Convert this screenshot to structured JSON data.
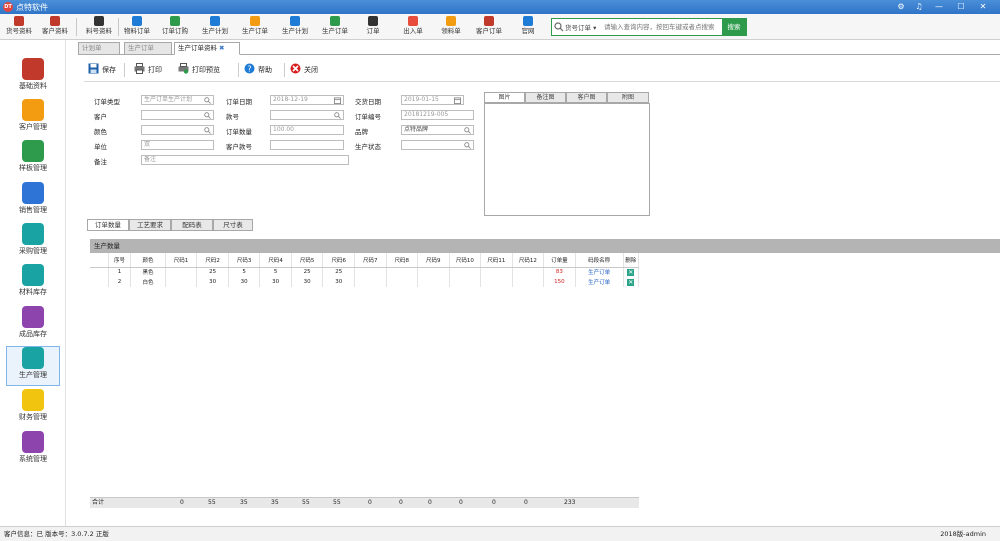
{
  "window": {
    "app_title": "点特软件",
    "logo_text": "DT",
    "controls": [
      "⚙",
      "♫",
      "—",
      "☐",
      "✕"
    ]
  },
  "toolbar": {
    "buttons": [
      {
        "label": "货号资料",
        "icon": "document-icon",
        "color": "#c0392b"
      },
      {
        "label": "客户资料",
        "icon": "contacts-icon",
        "color": "#c0392b"
      },
      {
        "label": "料号资料",
        "icon": "material-icon",
        "color": "#333333"
      },
      {
        "label": "物料订单",
        "icon": "order-icon",
        "color": "#1e7bd6"
      },
      {
        "label": "订单订购",
        "icon": "purchase-icon",
        "color": "#2e9b4c"
      },
      {
        "label": "生产计划",
        "icon": "plan-icon",
        "color": "#1e7bd6"
      },
      {
        "label": "生产订单",
        "icon": "production-icon",
        "color": "#f39c12"
      },
      {
        "label": "生产计划",
        "icon": "schedule-icon",
        "color": "#1e7bd6"
      },
      {
        "label": "生产订单",
        "icon": "workorder-icon",
        "color": "#2e9b4c"
      },
      {
        "label": "订单",
        "icon": "chart-icon",
        "color": "#333333"
      },
      {
        "label": "出入单",
        "icon": "flag-icon",
        "color": "#e74c3c"
      },
      {
        "label": "领料单",
        "icon": "box-icon",
        "color": "#f39c12"
      },
      {
        "label": "客户订单",
        "icon": "user-icon",
        "color": "#c0392b"
      },
      {
        "label": "官网",
        "icon": "browser-icon",
        "color": "#1e7bd6"
      }
    ]
  },
  "search": {
    "combo": "货号订单 ▾",
    "placeholder": "请输入查询内容，按回车键或者点搜索",
    "button": "搜索"
  },
  "sidebar": {
    "items": [
      {
        "label": "基础资料",
        "color": "#c0392b"
      },
      {
        "label": "客户管理",
        "color": "#f39c12"
      },
      {
        "label": "样板管理",
        "color": "#2e9b4c"
      },
      {
        "label": "销售管理",
        "color": "#2e74d6"
      },
      {
        "label": "采购管理",
        "color": "#1aa3a3"
      },
      {
        "label": "材料库存",
        "color": "#1aa3a3"
      },
      {
        "label": "成品库存",
        "color": "#8e44ad"
      },
      {
        "label": "生产管理",
        "color": "#1aa3a3"
      },
      {
        "label": "财务管理",
        "color": "#f1c40f"
      },
      {
        "label": "系统管理",
        "color": "#8e44ad"
      }
    ]
  },
  "doc_tabs": [
    {
      "label": "计划单",
      "active": false
    },
    {
      "label": "生产订单",
      "active": false
    },
    {
      "label": "生产订单资料",
      "active": true
    }
  ],
  "actions": [
    {
      "label": "保存",
      "color": "#1e5fa8"
    },
    {
      "label": "打印",
      "color": "#555555"
    },
    {
      "label": "打印预览",
      "color": "#2e9b4c"
    },
    {
      "label": "帮助",
      "color": "#1e7bd6"
    },
    {
      "label": "关闭",
      "color": "#d62020"
    }
  ],
  "form": {
    "order_type_label": "订单类型",
    "order_type_value": "生产订单生产计划",
    "order_date_label": "订单日期",
    "order_date_value": "2018-12-19",
    "delivery_date_label": "交货日期",
    "delivery_date_value": "2019-01-15",
    "customer_label": "客户",
    "customer_value": "",
    "style_label": "款号",
    "style_value": "",
    "order_no_label": "订单编号",
    "order_no_value": "20181219-005",
    "color_label": "颜色",
    "color_value": "",
    "quantity_label": "订单数量",
    "quantity_value": "100.00",
    "brand_label": "品牌",
    "brand_value": "点特品牌",
    "unit_label": "单位",
    "unit_value": "双",
    "customer_style_label": "客户款号",
    "customer_style_value": "",
    "status_label": "生产状态",
    "status_value": "",
    "remark_label": "备注",
    "remark_value": "备注"
  },
  "right_tabs": [
    "图片",
    "备注图",
    "客户图",
    "附图"
  ],
  "lower_tabs": [
    "订单数量",
    "工艺要求",
    "配码表",
    "尺寸表"
  ],
  "grid": {
    "section_title": "生产数量",
    "columns": [
      "序号",
      "颜色",
      "尺码1",
      "尺码2",
      "尺码3",
      "尺码4",
      "尺码5",
      "尺码6",
      "尺码7",
      "尺码8",
      "尺码9",
      "尺码10",
      "尺码11",
      "尺码12",
      "订单量",
      "码段名称",
      "删除"
    ],
    "rows": [
      {
        "no": "1",
        "color": "黑色",
        "c1": "",
        "c2": "25",
        "c3": "5",
        "c4": "5",
        "c5": "25",
        "c6": "25",
        "total": "83",
        "size_group": "生产订单"
      },
      {
        "no": "2",
        "color": "白色",
        "c1": "",
        "c2": "30",
        "c3": "30",
        "c4": "30",
        "c5": "30",
        "c6": "30",
        "total": "150",
        "size_group": "生产订单"
      }
    ],
    "totals": {
      "label": "合计",
      "v1": "0",
      "v2": "55",
      "v3": "35",
      "v4": "35",
      "v5": "55",
      "v6": "55",
      "v7": "0",
      "v8": "0",
      "v9": "0",
      "v10": "0",
      "v11": "0",
      "v12": "0",
      "total": "233"
    }
  },
  "status": {
    "left": "客户信息：已  版本号：3.0.7.2 正版",
    "right": "2018版-admin"
  }
}
